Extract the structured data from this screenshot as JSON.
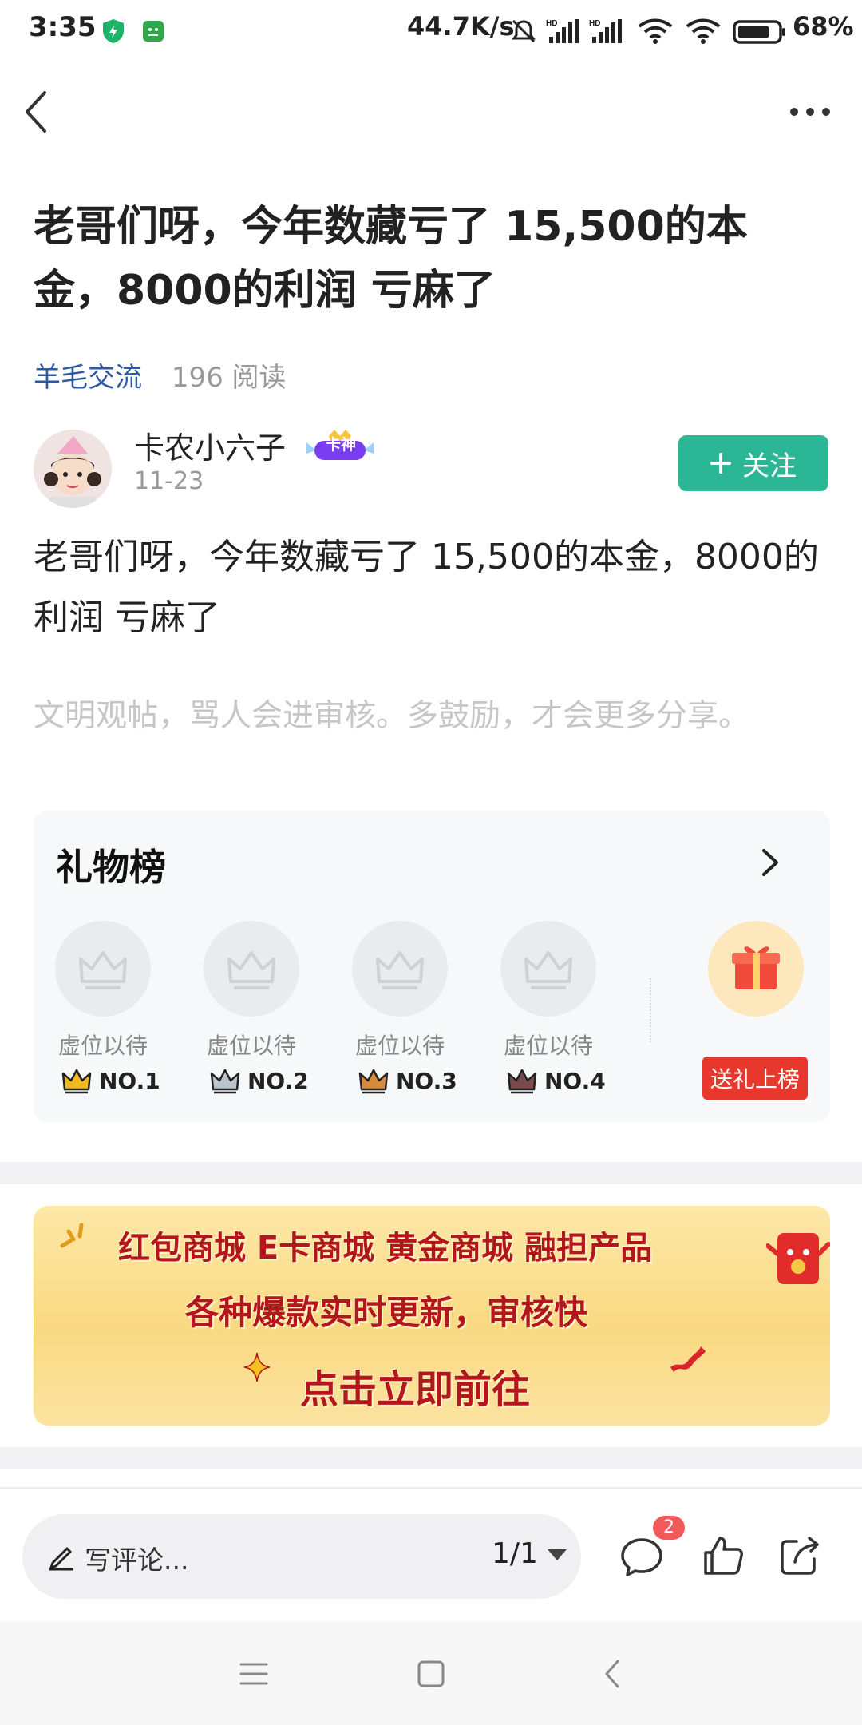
{
  "status_bar": {
    "time": "3:35",
    "net_speed": "44.7K/s",
    "battery": "68%",
    "icons": [
      "shield-icon",
      "android-icon",
      "mute-icon",
      "signal-hd-icon",
      "signal-hd-icon",
      "wifi-icon",
      "wifi-icon",
      "battery-icon"
    ]
  },
  "nav": {
    "back_icon": "back-arrow-icon",
    "more_icon": "more-dots-icon"
  },
  "post": {
    "title": "老哥们呀，今年数藏亏了 15,500的本金，8000的利润 亏麻了",
    "category": "羊毛交流",
    "reads": "196 阅读",
    "author": {
      "name": "卡农小六子",
      "badge": "卡神",
      "date": "11-23"
    },
    "follow_label": "关注",
    "body": "老哥们呀，今年数藏亏了  15,500的本金，8000的利润  亏麻了",
    "hint": "文明观帖，骂人会进审核。多鼓励，才会更多分享。"
  },
  "gift_board": {
    "title": "礼物榜",
    "slots": [
      {
        "label": "虚位以待",
        "rank": "NO.1",
        "crown_color": "#f2b81f"
      },
      {
        "label": "虚位以待",
        "rank": "NO.2",
        "crown_color": "#b9c3cc"
      },
      {
        "label": "虚位以待",
        "rank": "NO.3",
        "crown_color": "#d98a3b"
      },
      {
        "label": "虚位以待",
        "rank": "NO.4",
        "crown_color": "#7a4a4a"
      }
    ],
    "send_label": "送礼上榜"
  },
  "banner": {
    "line1": "红包商城  E卡商城  黄金商城  融担产品",
    "line2": "各种爆款实时更新，审核快",
    "line3": "点击立即前往"
  },
  "bottom_bar": {
    "comment_placeholder": "写评论...",
    "page_indicator": "1/1",
    "comment_count": "2"
  },
  "colors": {
    "accent_green": "#2bb795",
    "category_blue": "#2c5aa0",
    "send_red": "#e8372c"
  }
}
